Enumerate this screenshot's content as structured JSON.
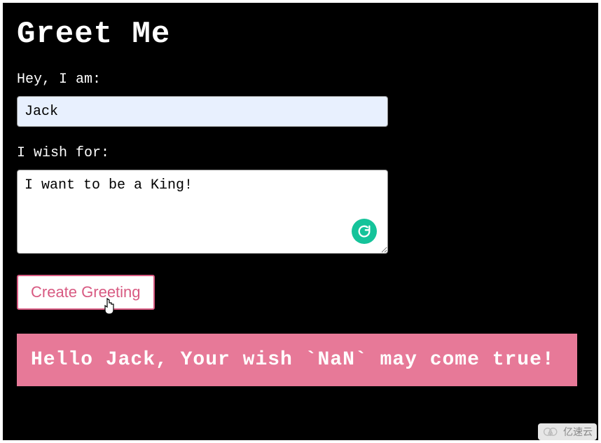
{
  "header": {
    "title": "Greet Me"
  },
  "form": {
    "name_label": "Hey, I am:",
    "name_value": "Jack",
    "wish_label": "I wish for:",
    "wish_value": "I want to be a King!",
    "submit_label": "Create Greeting"
  },
  "output": {
    "message": "Hello Jack, Your wish `NaN` may come true!"
  },
  "watermark": {
    "text": "亿速云"
  },
  "colors": {
    "accent": "#e77998",
    "button_border": "#d85a82",
    "grammarly": "#15c39a",
    "autofill_bg": "#e8f0fe"
  }
}
